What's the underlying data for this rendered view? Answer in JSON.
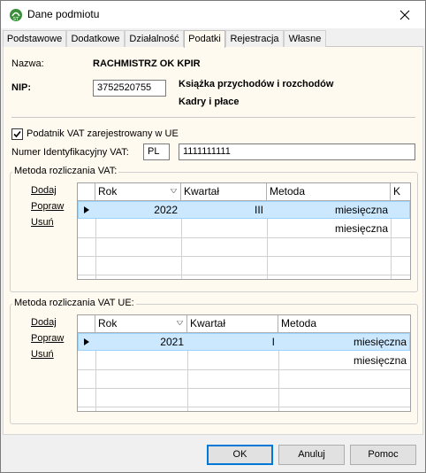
{
  "window": {
    "title": "Dane podmiotu"
  },
  "tabs": [
    {
      "label": "Podstawowe"
    },
    {
      "label": "Dodatkowe"
    },
    {
      "label": "Działalność"
    },
    {
      "label": "Podatki"
    },
    {
      "label": "Rejestracja"
    },
    {
      "label": "Własne"
    }
  ],
  "active_tab": "Podatki",
  "info": {
    "name_label": "Nazwa:",
    "name_value": "RACHMISTRZ OK KPIR",
    "nip_label": "NIP:",
    "nip_value": "3752520755",
    "book_type": "Książka przychodów i rozchodów",
    "payroll": "Kadry i płace"
  },
  "vat": {
    "registered_label": "Podatnik VAT zarejestrowany w UE",
    "registered_checked": true,
    "vat_id_label": "Numer Identyfikacyjny VAT:",
    "country_code": "PL",
    "vat_id_value": "1111111111"
  },
  "links": {
    "add": "Dodaj",
    "edit": "Popraw",
    "delete": "Usuń"
  },
  "vat_method": {
    "title": "Metoda rozliczania VAT:",
    "columns": [
      "Rok",
      "Kwartał",
      "Metoda",
      "K"
    ],
    "rows": [
      {
        "year": "2022",
        "quarter": "III",
        "method": "miesięczna"
      },
      {
        "year": "",
        "quarter": "",
        "method": "miesięczna"
      }
    ]
  },
  "vat_ue_method": {
    "title": "Metoda rozliczania VAT UE:",
    "columns": [
      "Rok",
      "Kwartał",
      "Metoda"
    ],
    "rows": [
      {
        "year": "2021",
        "quarter": "I",
        "method": "miesięczna"
      },
      {
        "year": "",
        "quarter": "",
        "method": "miesięczna"
      }
    ]
  },
  "buttons": {
    "ok": "OK",
    "cancel": "Anuluj",
    "help": "Pomoc"
  },
  "colors": {
    "selection": "#cce8ff",
    "selection_border": "#99d1ff",
    "panel_bg": "#fffaf0",
    "accent": "#0078d7"
  }
}
